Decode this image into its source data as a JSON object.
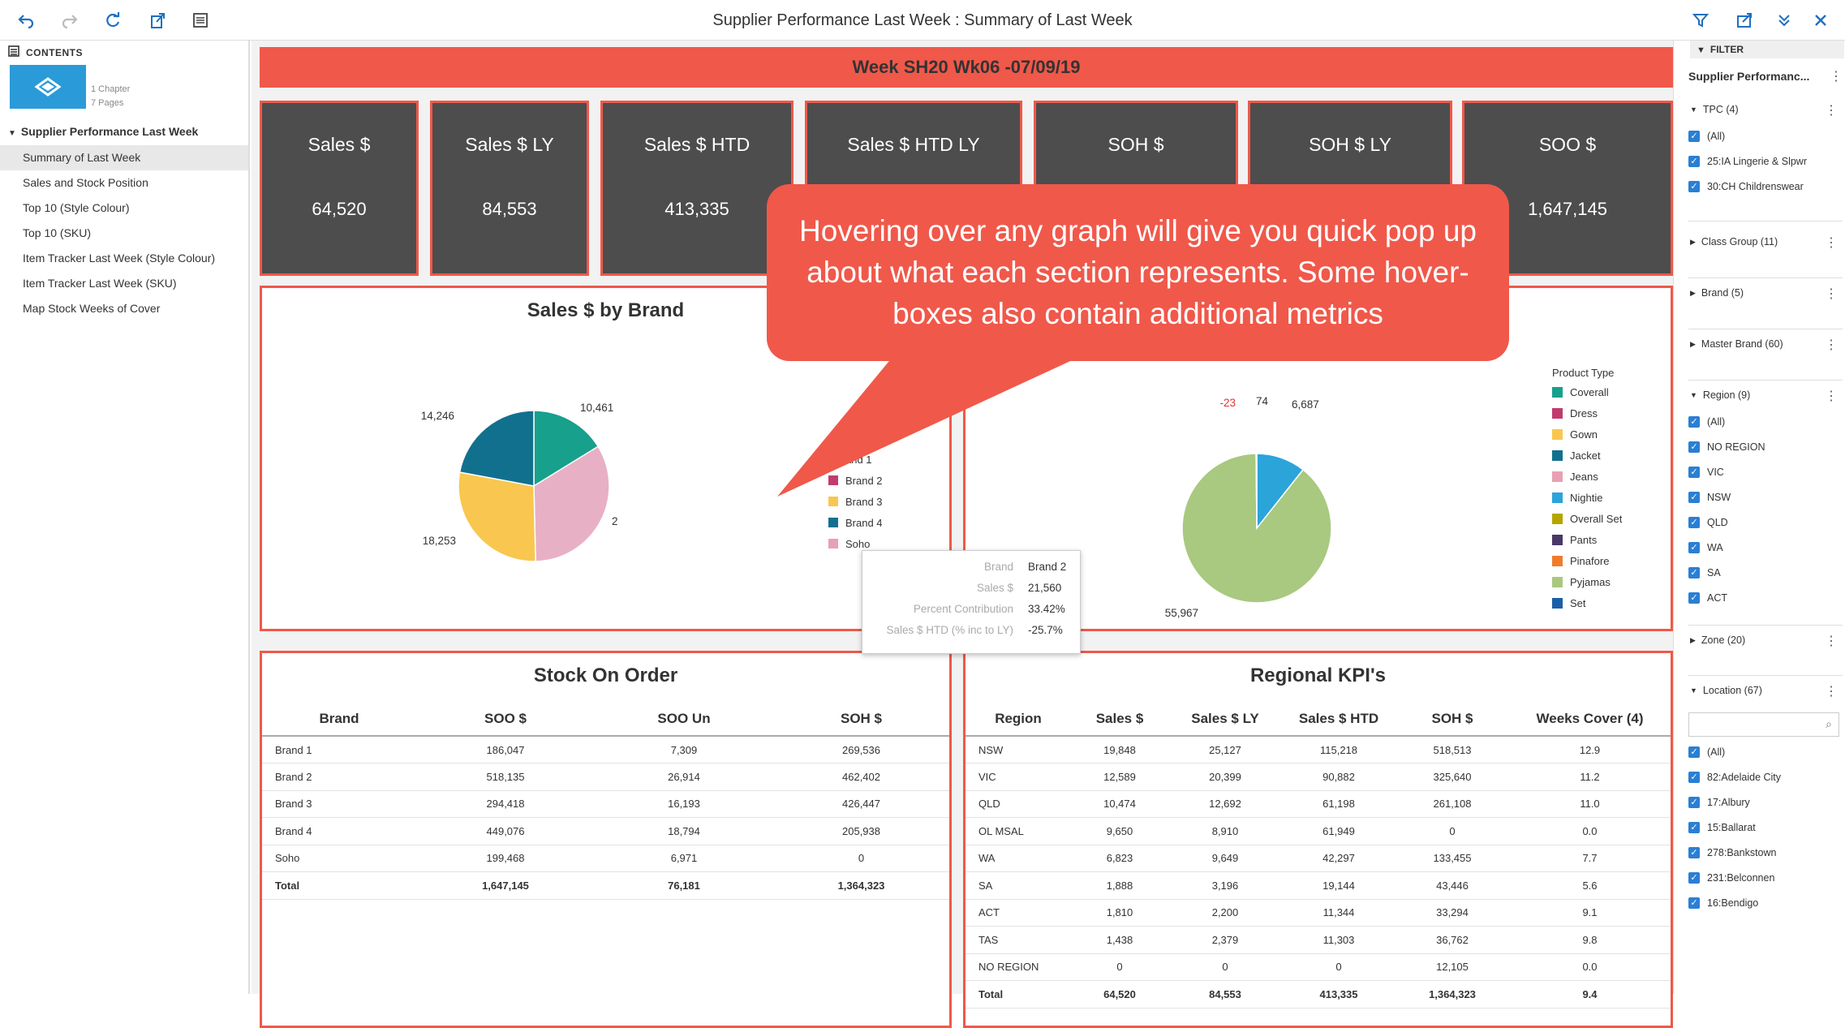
{
  "app": {
    "title": "Supplier Performance Last Week : Summary of Last Week"
  },
  "toolbar": {
    "icons": [
      "undo-icon",
      "redo-icon",
      "refresh-icon",
      "export-icon",
      "list-icon"
    ],
    "right_icons": [
      "filter-icon",
      "share-icon",
      "chevron-double-down-icon",
      "close-icon"
    ]
  },
  "sidebar": {
    "contents_label": "CONTENTS",
    "thumb_chapters": "1 Chapter",
    "thumb_pages": "7 Pages",
    "chapter": "Supplier Performance Last Week",
    "items": [
      {
        "label": "Summary of Last Week",
        "active": true
      },
      {
        "label": "Sales and Stock Position"
      },
      {
        "label": "Top 10 (Style Colour)"
      },
      {
        "label": "Top 10 (SKU)"
      },
      {
        "label": "Item Tracker Last Week (Style Colour)"
      },
      {
        "label": "Item Tracker Last Week (SKU)"
      },
      {
        "label": "Map Stock Weeks of Cover"
      }
    ]
  },
  "banner": {
    "text": "Week SH20 Wk06 -07/09/19"
  },
  "kpis": [
    {
      "label": "Sales $",
      "value": "64,520"
    },
    {
      "label": "Sales $ LY",
      "value": "84,553"
    },
    {
      "label": "Sales $ HTD",
      "value": "413,335"
    },
    {
      "label": "Sales $ HTD LY",
      "value": ""
    },
    {
      "label": "SOH $",
      "value": ""
    },
    {
      "label": "SOH $ LY",
      "value": ""
    },
    {
      "label": "SOO $",
      "value": "1,647,145"
    }
  ],
  "sales_by_brand": {
    "title": "Sales $ by Brand",
    "slice_labels": [
      "10,461",
      "14,246",
      "18,253"
    ],
    "partial_label": "2",
    "legend": [
      {
        "name": "Brand 1",
        "color": "#17a08c",
        "visible_text": "and 1"
      },
      {
        "name": "Brand 2",
        "color": "#c13b6f",
        "visible_text": "Brand 2"
      },
      {
        "name": "Brand 3",
        "color": "#f9c74f",
        "visible_text": "Brand 3"
      },
      {
        "name": "Brand 4",
        "color": "#12708f",
        "visible_text": "Brand 4"
      },
      {
        "name": "Soho",
        "color": "#e8a0b4",
        "visible_text": "Soho"
      }
    ]
  },
  "tooltip": {
    "rows": [
      {
        "k": "Brand",
        "v": "Brand 2"
      },
      {
        "k": "Sales $",
        "v": "21,560"
      },
      {
        "k": "Percent Contribution",
        "v": "33.42%"
      },
      {
        "k": "Sales $ HTD (% inc to LY)",
        "v": "-25.7%"
      }
    ]
  },
  "product_type": {
    "legend_title": "Product Type",
    "slice_labels": [
      "-23",
      "74",
      "6,687",
      "55,967"
    ],
    "legend": [
      {
        "name": "Coverall",
        "color": "#17a08c"
      },
      {
        "name": "Dress",
        "color": "#c13b6f"
      },
      {
        "name": "Gown",
        "color": "#f9c74f"
      },
      {
        "name": "Jacket",
        "color": "#12708f"
      },
      {
        "name": "Jeans",
        "color": "#e8a0b4"
      },
      {
        "name": "Nightie",
        "color": "#2ba4da"
      },
      {
        "name": "Overall Set",
        "color": "#b5a500"
      },
      {
        "name": "Pants",
        "color": "#4a3868"
      },
      {
        "name": "Pinafore",
        "color": "#f07c2a"
      },
      {
        "name": "Pyjamas",
        "color": "#a8c97f"
      },
      {
        "name": "Set",
        "color": "#1b5fa8"
      }
    ]
  },
  "chart_data": [
    {
      "type": "pie",
      "title": "Sales $ by Brand",
      "categories": [
        "Brand 1",
        "Brand 2",
        "Brand 3",
        "Brand 4"
      ],
      "values": [
        10461,
        21560,
        18253,
        14246
      ],
      "colors": [
        "#17a08c",
        "#e8b0c4",
        "#f9c74f",
        "#12708f"
      ]
    },
    {
      "type": "pie",
      "categories": [
        "Nightie",
        "Pyjamas",
        "Jacket",
        "Pants"
      ],
      "values": [
        6687,
        55967,
        74,
        -23
      ],
      "colors": [
        "#2ba4da",
        "#a8c97f",
        "#2e4a3a",
        "#4a3868"
      ]
    }
  ],
  "stock_on_order": {
    "title": "Stock On Order",
    "columns": [
      "Brand",
      "SOO $",
      "SOO Un",
      "SOH $"
    ],
    "rows": [
      [
        "Brand 1",
        "186,047",
        "7,309",
        "269,536"
      ],
      [
        "Brand 2",
        "518,135",
        "26,914",
        "462,402"
      ],
      [
        "Brand 3",
        "294,418",
        "16,193",
        "426,447"
      ],
      [
        "Brand 4",
        "449,076",
        "18,794",
        "205,938"
      ],
      [
        "Soho",
        "199,468",
        "6,971",
        "0"
      ],
      [
        "Total",
        "1,647,145",
        "76,181",
        "1,364,323"
      ]
    ]
  },
  "regional_kpis": {
    "title": "Regional KPI's",
    "columns": [
      "Region",
      "Sales $",
      "Sales $ LY",
      "Sales $ HTD",
      "SOH $",
      "Weeks Cover (4)"
    ],
    "rows": [
      [
        "NSW",
        "19,848",
        "25,127",
        "115,218",
        "518,513",
        "12.9"
      ],
      [
        "VIC",
        "12,589",
        "20,399",
        "90,882",
        "325,640",
        "11.2"
      ],
      [
        "QLD",
        "10,474",
        "12,692",
        "61,198",
        "261,108",
        "11.0"
      ],
      [
        "OL MSAL",
        "9,650",
        "8,910",
        "61,949",
        "0",
        "0.0"
      ],
      [
        "WA",
        "6,823",
        "9,649",
        "42,297",
        "133,455",
        "7.7"
      ],
      [
        "SA",
        "1,888",
        "3,196",
        "19,144",
        "43,446",
        "5.6"
      ],
      [
        "ACT",
        "1,810",
        "2,200",
        "11,344",
        "33,294",
        "9.1"
      ],
      [
        "TAS",
        "1,438",
        "2,379",
        "11,303",
        "36,762",
        "9.8"
      ],
      [
        "NO REGION",
        "0",
        "0",
        "0",
        "12,105",
        "0.0"
      ],
      [
        "Total",
        "64,520",
        "84,553",
        "413,335",
        "1,364,323",
        "9.4"
      ]
    ]
  },
  "callout": {
    "text": "Hovering over any graph will give you quick pop up about what each section represents. Some hover-boxes also contain additional metrics"
  },
  "filter": {
    "header": "FILTER",
    "title": "Supplier Performanc...",
    "tpc": {
      "label": "TPC (4)",
      "items": [
        "(All)",
        "25:IA Lingerie & Slpwr",
        "30:CH Childrenswear"
      ]
    },
    "groups": [
      "Class Group (11)",
      "Brand (5)",
      "Master Brand (60)"
    ],
    "region": {
      "label": "Region (9)",
      "items": [
        "(All)",
        "NO REGION",
        "VIC",
        "NSW",
        "QLD",
        "WA",
        "SA",
        "ACT"
      ]
    },
    "zone": "Zone (20)",
    "location": {
      "label": "Location (67)",
      "search_placeholder": "",
      "items": [
        "(All)",
        "82:Adelaide City",
        "17:Albury",
        "15:Ballarat",
        "278:Bankstown",
        "231:Belconnen",
        "16:Bendigo"
      ]
    }
  }
}
